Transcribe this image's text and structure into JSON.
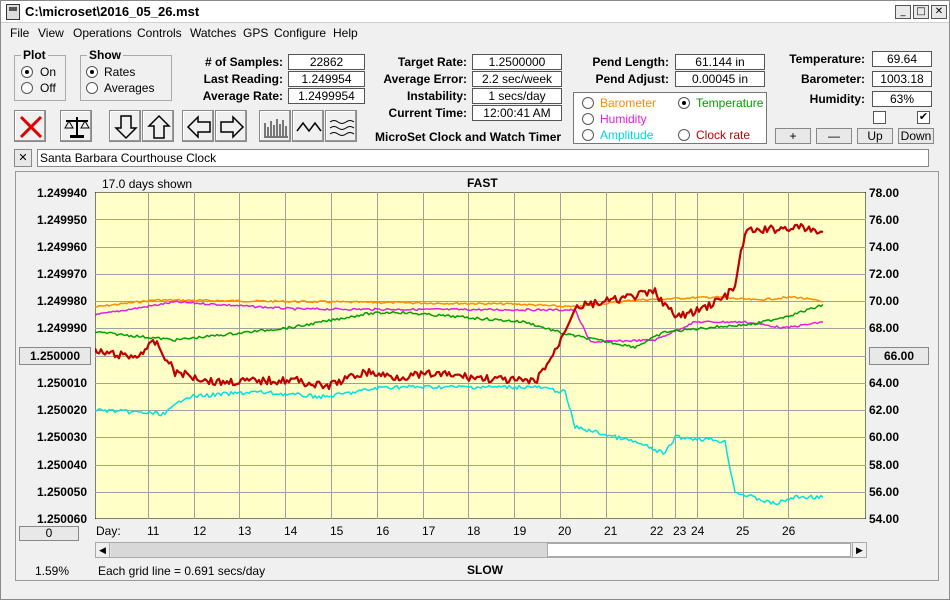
{
  "window": {
    "title": "C:\\microset\\2016_05_26.mst"
  },
  "menu": [
    "File",
    "View",
    "Operations",
    "Controls",
    "Watches",
    "GPS",
    "Configure",
    "Help"
  ],
  "plot_group": {
    "title": "Plot",
    "on": "On",
    "off": "Off",
    "selected": "On"
  },
  "show_group": {
    "title": "Show",
    "rates": "Rates",
    "averages": "Averages",
    "selected": "Rates"
  },
  "stats": {
    "samples_label": "# of Samples:",
    "samples": "22862",
    "last_label": "Last Reading:",
    "last": "1.249954",
    "avgrate_label": "Average Rate:",
    "avgrate": "1.2499954",
    "target_label": "Target Rate:",
    "target": "1.2500000",
    "avgerr_label": "Average Error:",
    "avgerr": "2.2 sec/week",
    "instab_label": "Instability:",
    "instab": "1 secs/day",
    "time_label": "Current Time:",
    "time": "12:00:41 AM",
    "pendlen_label": "Pend Length:",
    "pendlen": "61.144 in",
    "pendadj_label": "Pend Adjust:",
    "pendadj": "0.00045 in",
    "temp_label": "Temperature:",
    "temp": "69.64",
    "baro_label": "Barometer:",
    "baro": "1003.18",
    "hum_label": "Humidity:",
    "hum": "63%"
  },
  "app_caption": "MicroSet Clock and Watch Timer",
  "sensor_select": {
    "barometer": "Barometer",
    "temperature": "Temperature",
    "humidity": "Humidity",
    "amplitude": "Amplitude",
    "clockrate": "Clock rate",
    "selected": "Temperature"
  },
  "sensor_colors": {
    "barometer": "#ff8c00",
    "temperature": "#00a000",
    "humidity": "#e020e0",
    "amplitude": "#00e0e0",
    "clockrate": "#c00000"
  },
  "adjust_buttons": {
    "plus": "+",
    "minus": "—",
    "up": "Up",
    "down": "Down"
  },
  "checkboxes": {
    "left_checked": false,
    "right_checked": true
  },
  "close_x": "✕",
  "clock_name": "Santa Barbara Courthouse Clock",
  "chart": {
    "days_shown": "17.0 days shown",
    "top_label": "FAST",
    "bottom_label": "SLOW",
    "grid_note": "Each grid line = 0.691 secs/day",
    "left_ticks": [
      "1.249940",
      "1.249950",
      "1.249960",
      "1.249970",
      "1.249980",
      "1.249990",
      "1.250000",
      "1.250010",
      "1.250020",
      "1.250030",
      "1.250040",
      "1.250050",
      "1.250060"
    ],
    "right_ticks": [
      "78.00",
      "76.00",
      "74.00",
      "72.00",
      "70.00",
      "68.00",
      "66.00",
      "64.00",
      "62.00",
      "60.00",
      "58.00",
      "56.00",
      "54.00"
    ],
    "left_box_value": "1.250000",
    "right_box_value": "66.00",
    "left_bottom_box": "0",
    "day_prefix": "Day:",
    "days": [
      "11",
      "12",
      "13",
      "14",
      "15",
      "16",
      "17",
      "18",
      "19",
      "20",
      "21",
      "22",
      "23",
      "24",
      "25",
      "26"
    ],
    "percent": "1.59%",
    "background": "#ffffc8"
  }
}
